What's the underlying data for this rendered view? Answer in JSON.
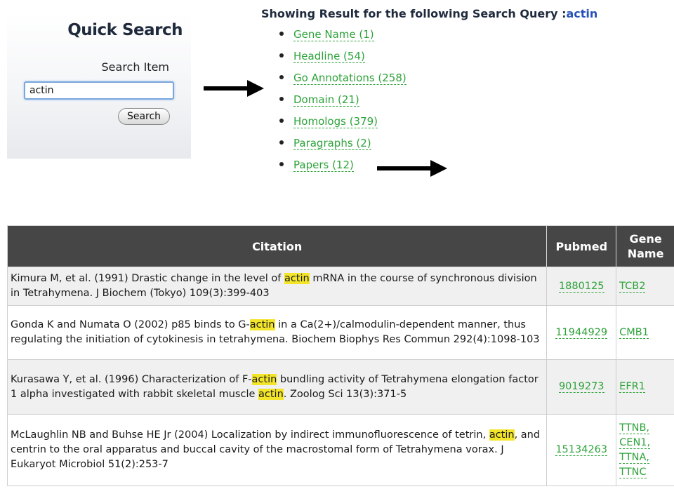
{
  "quick_search": {
    "title": "Quick Search",
    "label": "Search Item",
    "input_value": "actin",
    "button_label": "Search"
  },
  "results": {
    "heading_prefix": "Showing Result for the following Search Query :",
    "query": "actin",
    "items": [
      {
        "label": "Gene Name (1)"
      },
      {
        "label": "Headline (54)"
      },
      {
        "label": "Go Annotations (258)"
      },
      {
        "label": "Domain (21)"
      },
      {
        "label": "Homologs (379)"
      },
      {
        "label": "Paragraphs (2)"
      },
      {
        "label": "Papers (12)"
      }
    ]
  },
  "table": {
    "headers": {
      "citation": "Citation",
      "pubmed": "Pubmed",
      "gene_name_1": "Gene",
      "gene_name_2": "Name"
    },
    "rows": [
      {
        "cit_a": "Kimura M, et al. (1991) Drastic change in the level of ",
        "cit_hl1": "actin",
        "cit_b": " mRNA in the course of synchronous division in Tetrahymena. J Biochem (Tokyo) 109(3):399-403",
        "pubmed": "1880125",
        "genes": [
          "TCB2"
        ]
      },
      {
        "cit_a": "Gonda K and Numata O (2002) p85 binds to G-",
        "cit_hl1": "actin",
        "cit_b": " in a Ca(2+)/calmodulin-dependent manner, thus regulating the initiation of cytokinesis in tetrahymena. Biochem Biophys Res Commun 292(4):1098-103",
        "pubmed": "11944929",
        "genes": [
          "CMB1"
        ]
      },
      {
        "cit_a": "Kurasawa Y, et al. (1996) Characterization of F-",
        "cit_hl1": "actin",
        "cit_b": " bundling activity of Tetrahymena elongation factor 1 alpha investigated with rabbit skeletal muscle ",
        "cit_hl2": "actin",
        "cit_c": ". Zoolog Sci 13(3):371-5",
        "pubmed": "9019273",
        "genes": [
          "EFR1"
        ]
      },
      {
        "cit_a": "McLaughlin NB and Buhse HE Jr (2004) Localization by indirect immunofluorescence of tetrin, ",
        "cit_hl1": "actin",
        "cit_b": ", and centrin to the oral apparatus and buccal cavity of the macrostomal form of Tetrahymena vorax. J Eukaryot Microbiol 51(2):253-7",
        "pubmed": "15134263",
        "genes": [
          "TTNB,",
          "CEN1,",
          "TTNA,",
          "TTNC"
        ]
      }
    ]
  }
}
